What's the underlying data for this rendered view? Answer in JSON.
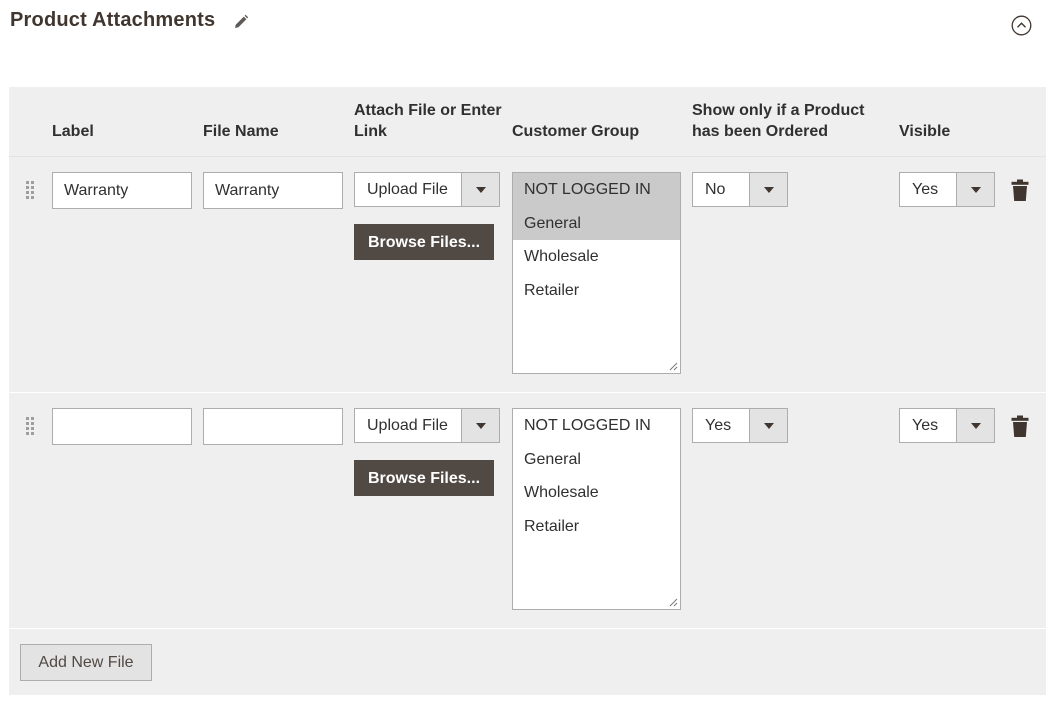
{
  "section": {
    "title": "Product Attachments",
    "edit_icon": "pencil-icon",
    "collapse_icon": "chevron-up-circle-icon"
  },
  "columns": {
    "label": "Label",
    "file_name": "File Name",
    "attach_line1": "Attach File or Enter",
    "attach_line2": "Link",
    "customer_group": "Customer Group",
    "show_ordered_line1": "Show only if a Product",
    "show_ordered_line2": "has been Ordered",
    "visible": "Visible"
  },
  "rows": [
    {
      "label": "Warranty",
      "file_name": "Warranty",
      "attach_type": "Upload File",
      "browse_label": "Browse Files...",
      "customer_groups": [
        {
          "name": "NOT LOGGED IN",
          "selected": true
        },
        {
          "name": "General",
          "selected": true
        },
        {
          "name": "Wholesale",
          "selected": false
        },
        {
          "name": "Retailer",
          "selected": false
        }
      ],
      "show_only_if_ordered": "No",
      "visible": "Yes"
    },
    {
      "label": "",
      "file_name": "",
      "attach_type": "Upload File",
      "browse_label": "Browse Files...",
      "customer_groups": [
        {
          "name": "NOT LOGGED IN",
          "selected": false
        },
        {
          "name": "General",
          "selected": false
        },
        {
          "name": "Wholesale",
          "selected": false
        },
        {
          "name": "Retailer",
          "selected": false
        }
      ],
      "show_only_if_ordered": "Yes",
      "visible": "Yes"
    }
  ],
  "footer": {
    "add_button_label": "Add New File"
  },
  "colors": {
    "title": "#41362f",
    "grid_bg": "#efefef",
    "browse_btn_bg": "#514943",
    "selected_option_bg": "#cacaca",
    "input_border": "#adadad"
  }
}
